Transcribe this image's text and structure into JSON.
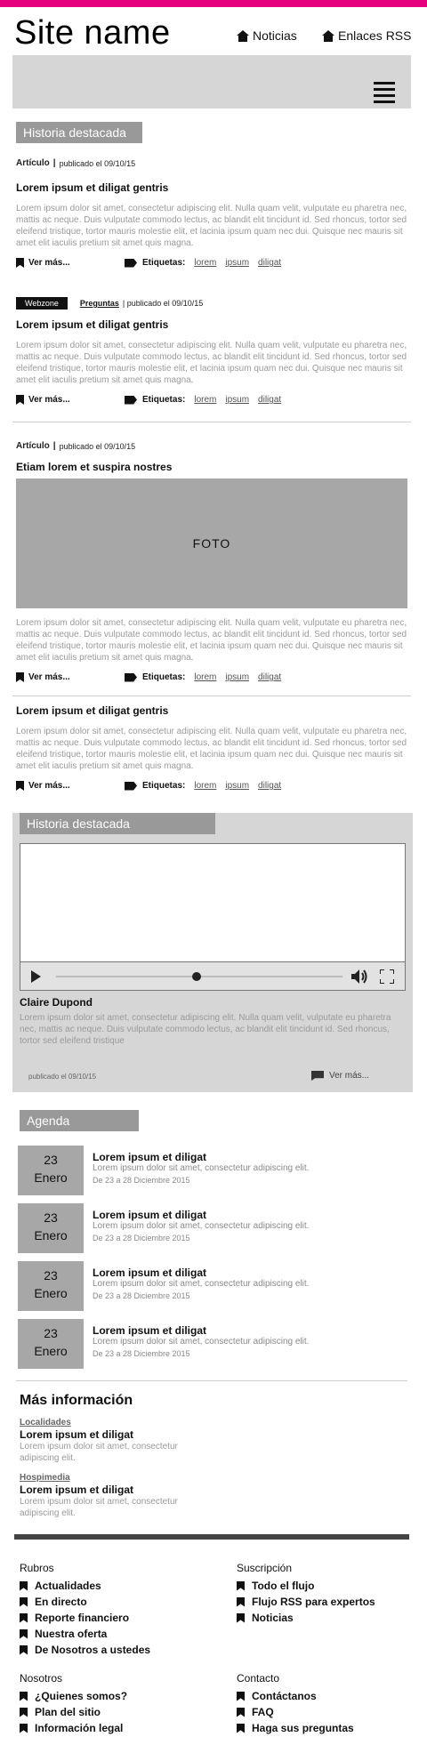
{
  "header": {
    "site_name": "Site name",
    "nav": [
      {
        "label": "Noticias",
        "icon": "home-icon"
      },
      {
        "label": "Enlaces RSS",
        "icon": "home-icon"
      }
    ]
  },
  "featured_tag": "Historia destacada",
  "articles": [
    {
      "category": "Artículo",
      "published": "publicado el 09/10/15",
      "title": "Lorem ipsum et diligat gentris",
      "body": "Lorem ipsum dolor sit amet, consectetur adipiscing elit. Nulla quam velit, vulputate eu pharetra nec, mattis ac neque. Duis vulputate commodo lectus, ac blandit elit tincidunt id. Sed rhoncus, tortor sed eleifend tristique, tortor mauris molestie elit, et lacinia ipsum quam nec dui. Quisque nec mauris sit amet elit iaculis pretium sit amet quis magna.",
      "read_more": "Ver más...",
      "tags_label": "Etiquetas:",
      "tags": [
        "lorem",
        "ipsum",
        "diligat"
      ]
    },
    {
      "badge": "Webzone",
      "category": "Preguntas",
      "published": "| publicado el 09/10/15",
      "title": "Lorem ipsum et diligat gentris",
      "body": "Lorem ipsum dolor sit amet, consectetur adipiscing elit. Nulla quam velit, vulputate eu pharetra nec, mattis ac neque. Duis vulputate commodo lectus, ac blandit elit tincidunt id. Sed rhoncus, tortor sed eleifend tristique, tortor mauris molestie elit, et lacinia ipsum quam nec dui. Quisque nec mauris sit amet elit iaculis pretium sit amet quis magna.",
      "read_more": "Ver más...",
      "tags_label": "Etiquetas:",
      "tags": [
        "lorem",
        "ipsum",
        "diligat"
      ]
    },
    {
      "category": "Artículo",
      "published": "publicado el 09/10/15",
      "title": "Etiam lorem et suspira nostres",
      "photo_label": "FOTO",
      "body": "Lorem ipsum dolor sit amet, consectetur adipiscing elit. Nulla quam velit, vulputate eu pharetra nec, mattis ac neque. Duis vulputate commodo lectus, ac blandit elit tincidunt id. Sed rhoncus, tortor sed eleifend tristique, tortor mauris molestie elit, et lacinia ipsum quam nec dui. Quisque nec mauris sit amet elit iaculis pretium sit amet quis magna.",
      "read_more": "Ver más...",
      "tags_label": "Etiquetas:",
      "tags": [
        "lorem",
        "ipsum",
        "diligat"
      ]
    },
    {
      "title": "Lorem ipsum et diligat gentris",
      "body": "Lorem ipsum dolor sit amet, consectetur adipiscing elit. Nulla quam velit, vulputate eu pharetra nec, mattis ac neque. Duis vulputate commodo lectus, ac blandit elit tincidunt id. Sed rhoncus, tortor sed eleifend tristique, tortor mauris molestie elit, et lacinia ipsum quam nec dui. Quisque nec mauris sit amet elit iaculis pretium sit amet quis magna.",
      "read_more": "Ver más...",
      "tags_label": "Etiquetas:",
      "tags": [
        "lorem",
        "ipsum",
        "diligat"
      ]
    }
  ],
  "featured_video": {
    "tag": "Historia destacada",
    "progress": 0.49,
    "author": "Claire Dupond",
    "body": "Lorem ipsum dolor sit amet, consectetur adipiscing elit. Nulla quam velit, vulputate eu pharetra nec, mattis ac neque. Duis vulputate commodo lectus, ac blandit elit tincidunt id. Sed rhoncus, tortor sed eleifend tristique",
    "published": "publicado el 09/10/15",
    "read_more": "Ver más..."
  },
  "agenda": {
    "title": "Agenda",
    "items": [
      {
        "day": "23",
        "month": "Enero",
        "title": "Lorem ipsum et diligat",
        "desc": "Lorem ipsum dolor sit amet, consectetur adipiscing elit.",
        "dates": "De 23 a 28 Diciembre 2015"
      },
      {
        "day": "23",
        "month": "Enero",
        "title": "Lorem ipsum et diligat",
        "desc": "Lorem ipsum dolor sit amet, consectetur adipiscing elit.",
        "dates": "De 23 a 28 Diciembre 2015"
      },
      {
        "day": "23",
        "month": "Enero",
        "title": "Lorem ipsum et diligat",
        "desc": "Lorem ipsum dolor sit amet, consectetur adipiscing elit.",
        "dates": "De 23 a 28 Diciembre 2015"
      },
      {
        "day": "23",
        "month": "Enero",
        "title": "Lorem ipsum et diligat",
        "desc": "Lorem ipsum dolor sit amet, consectetur adipiscing elit.",
        "dates": "De 23 a 28 Diciembre 2015"
      }
    ]
  },
  "more_info": {
    "title": "Más información",
    "items": [
      {
        "category": "Localidades",
        "title": "Lorem ipsum et diligat",
        "desc": "Lorem ipsum dolor sit amet, consectetur adipiscing elit."
      },
      {
        "category": "Hospimedia",
        "title": "Lorem ipsum et diligat",
        "desc": "Lorem ipsum dolor sit amet, consectetur adipiscing elit."
      }
    ]
  },
  "footer": {
    "columns": [
      {
        "title": "Rubros",
        "links": [
          "Actualidades",
          "En directo",
          "Reporte financiero",
          "Nuestra oferta",
          "De Nosotros a ustedes"
        ]
      },
      {
        "title": "Suscripción",
        "links": [
          "Todo el flujo",
          "Flujo RSS para expertos",
          "Noticias"
        ]
      },
      {
        "title": "Nosotros",
        "links": [
          "¿Quienes somos?",
          "Plan del sitio",
          "Información legal"
        ]
      },
      {
        "title": "Contacto",
        "links": [
          "Contáctanos",
          "FAQ",
          "Haga sus preguntas"
        ]
      }
    ]
  },
  "colors": {
    "accent": "#e6007e",
    "gray_block": "#d6d6d6",
    "gray_tag": "#999999"
  }
}
